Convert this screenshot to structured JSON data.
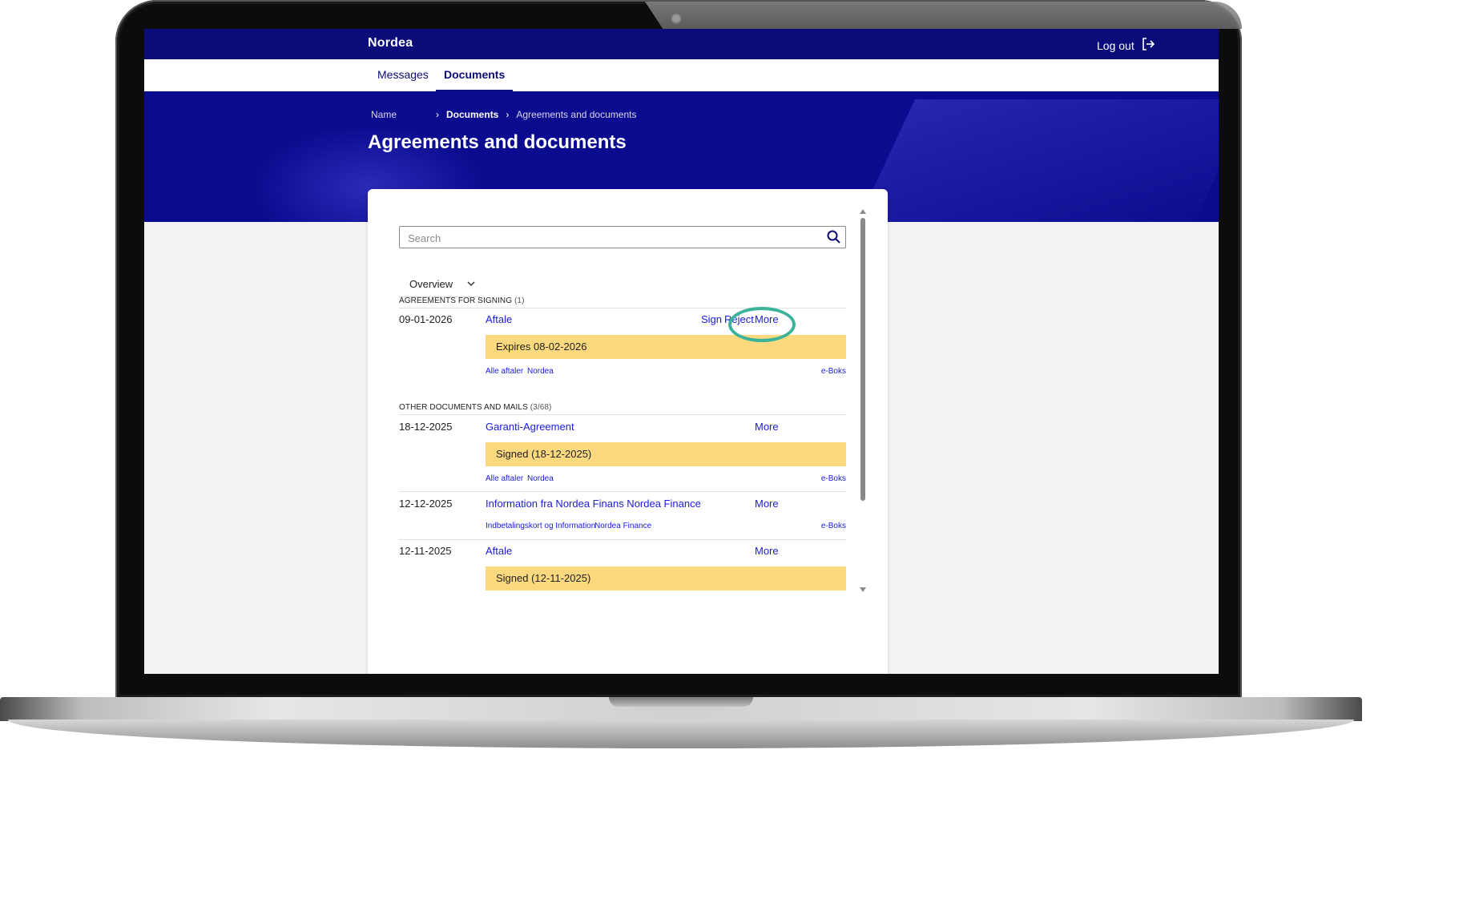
{
  "header": {
    "logo": "Nordea",
    "logout_label": "Log out"
  },
  "nav": {
    "tabs": [
      {
        "label": "Messages"
      },
      {
        "label": "Documents"
      }
    ],
    "active_tab": "Documents"
  },
  "breadcrumb": {
    "items": [
      "Name",
      "Documents",
      "Agreements and documents"
    ]
  },
  "page": {
    "title": "Agreements and documents"
  },
  "search": {
    "placeholder": "Search"
  },
  "filter": {
    "selected": "Overview"
  },
  "sections": {
    "signing": {
      "title": "AGREEMENTS FOR SIGNING",
      "count": "(1)",
      "items": [
        {
          "date": "09-01-2026",
          "title": "Aftale",
          "actions": [
            "Sign",
            "Reject",
            "More"
          ],
          "banner": "Expires 08-02-2026",
          "tags": [
            "Alle aftaler",
            "Nordea"
          ],
          "source": "e-Boks"
        }
      ]
    },
    "other": {
      "title": "OTHER DOCUMENTS AND MAILS",
      "count": "(3/68)",
      "items": [
        {
          "date": "18-12-2025",
          "title": "Garanti-Agreement",
          "action": "More",
          "banner": "Signed (18-12-2025)",
          "tags": [
            "Alle aftaler",
            "Nordea"
          ],
          "source": "e-Boks"
        },
        {
          "date": "12-12-2025",
          "title": "Information fra Nordea Finans Nordea Finance",
          "action": "More",
          "tags": [
            "Indbetalingskort og Information",
            "Nordea Finance"
          ],
          "source": "e-Boks"
        },
        {
          "date": "12-11-2025",
          "title": "Aftale",
          "action": "More",
          "banner": "Signed (12-11-2025)"
        }
      ]
    }
  },
  "colors": {
    "brand_navy": "#0b0b7a",
    "link_blue": "#1a1ae0",
    "banner_yellow": "#fcd97e",
    "highlight_ring": "#3bb39b",
    "page_background": "#f1f2f4"
  }
}
